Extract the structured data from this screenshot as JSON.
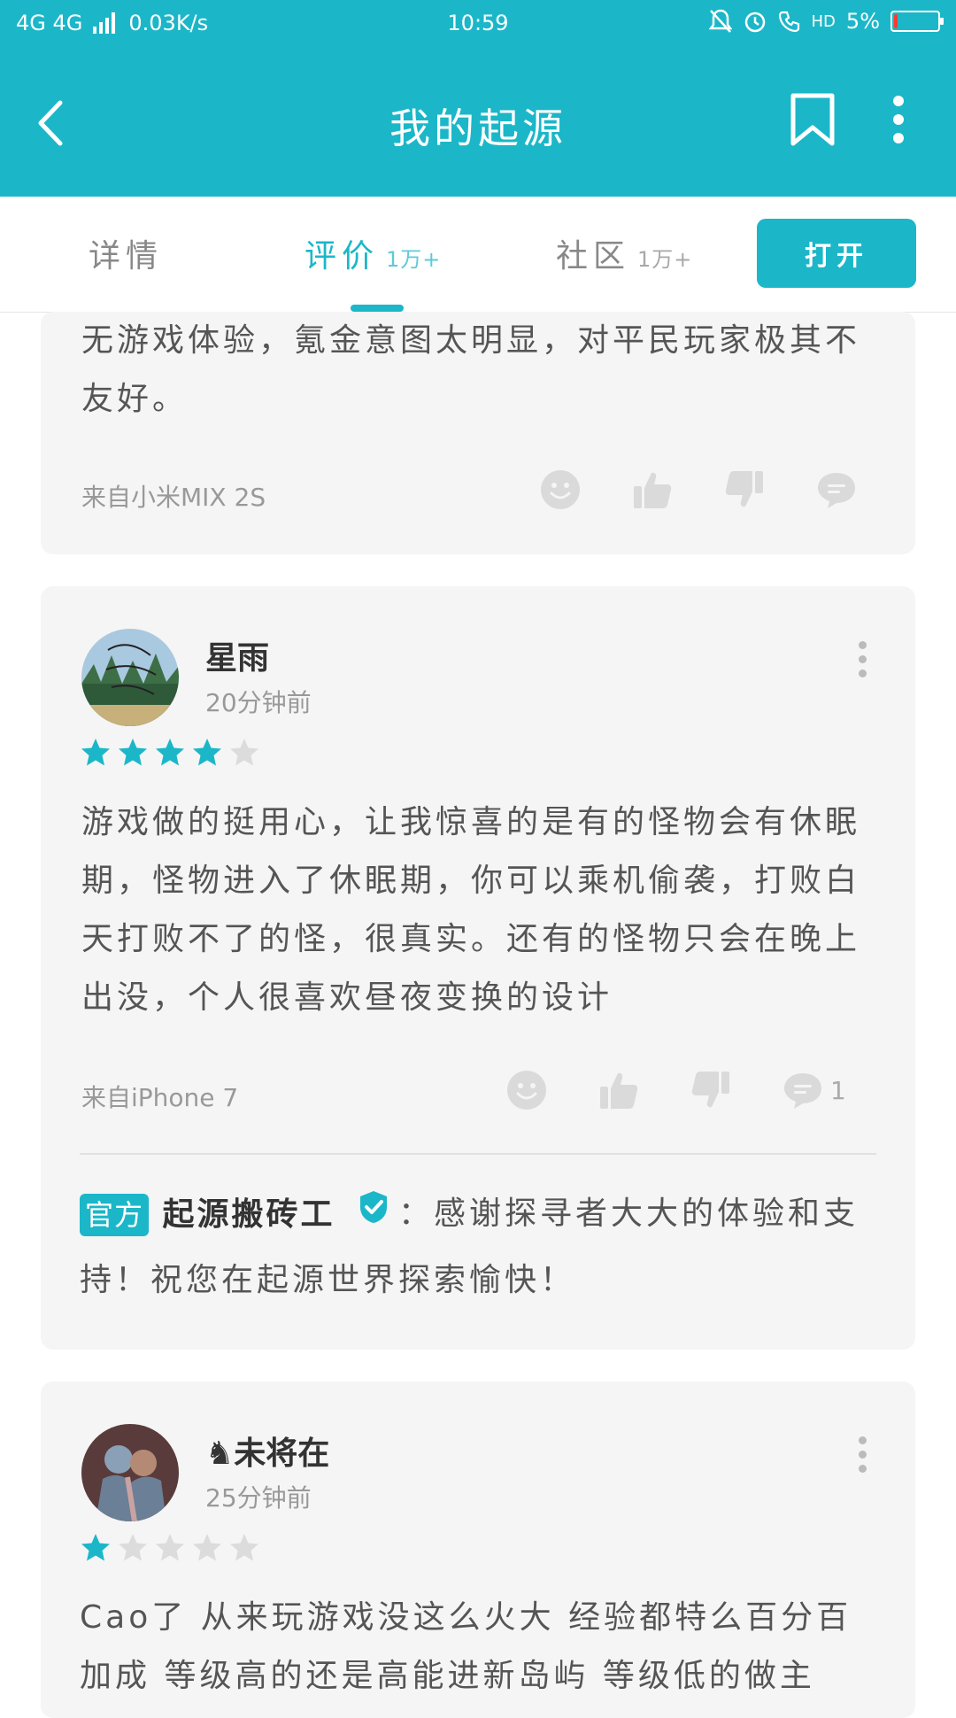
{
  "status_bar": {
    "network": "4G 4G",
    "speed": "0.03K/s",
    "time": "10:59",
    "hd": "HD",
    "battery": "5%",
    "battery_level": 0.05,
    "battery_color": "#ff3b30"
  },
  "app_bar": {
    "title": "我的起源",
    "bg_color": "#1bb7c8"
  },
  "tabs": [
    {
      "label": "详情",
      "count": ""
    },
    {
      "label": "评价",
      "count": "1万+"
    },
    {
      "label": "社区",
      "count": "1万+"
    }
  ],
  "open_button": "打开",
  "reviews": [
    {
      "text": "无游戏体验，氪金意图太明显，对平民玩家极其不友好。",
      "device": "来自小米MIX 2S",
      "comment_count": ""
    },
    {
      "username": "星雨",
      "time": "20分钟前",
      "rating": 4,
      "max_rating": 5,
      "text": "游戏做的挺用心，让我惊喜的是有的怪物会有休眠期，怪物进入了休眠期，你可以乘机偷袭，打败白天打败不了的怪，很真实。还有的怪物只会在晚上出没，个人很喜欢昼夜变换的设计",
      "device": "来自iPhone 7",
      "comment_count": "1",
      "official_reply": {
        "badge": "官方",
        "name": "起源搬砖工",
        "text": "：感谢探寻者大大的体验和支持！祝您在起源世界探索愉快！"
      }
    },
    {
      "username": "♞未将在",
      "time": "25分钟前",
      "rating": 1,
      "max_rating": 5,
      "text": "Cao了 从来玩游戏没这么火大 经验都特么百分百加成 等级高的还是高能进新岛屿 等级低的做主"
    }
  ],
  "colors": {
    "accent": "#1bb7c8",
    "card_bg": "#f5f5f5",
    "star_empty": "#dcdcdc",
    "icon_gray": "#dadada"
  }
}
